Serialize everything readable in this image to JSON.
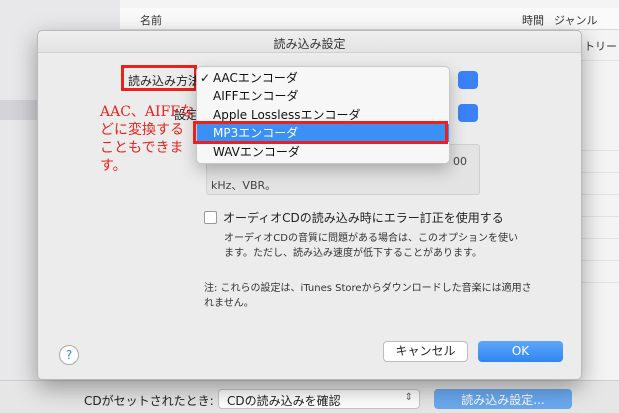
{
  "background": {
    "columns": {
      "name": "名前",
      "time": "時間",
      "genre": "ジャンル"
    },
    "tail_text": "トリー",
    "bottom_label": "CDがセットされたとき:",
    "bottom_select": "CDの読み込みを確認",
    "bottom_button": "読み込み設定..."
  },
  "dialog": {
    "title": "読み込み設定",
    "import_label": "読み込み方法",
    "setting_label": "設定",
    "info_tail": "00",
    "info_text": "kHz、VBR。",
    "checkbox_label": "オーディオCDの読み込み時にエラー訂正を使用する",
    "checkbox_desc": "オーディオCDの音質に問題がある場合は、このオプションを使います。ただし、読み込み速度が低下することがあります。",
    "note": "注: これらの設定は、iTunes Storeからダウンロードした音楽には適用されません。",
    "help": "?",
    "cancel": "キャンセル",
    "ok": "OK"
  },
  "annotation": {
    "text": "AAC、AIFFなどに変換することもできます。",
    "color": "#e8231d"
  },
  "menu": {
    "items": [
      {
        "label": "AACエンコーダ",
        "checked": "✓"
      },
      {
        "label": "AIFFエンコーダ"
      },
      {
        "label": "Apple Losslessエンコーダ"
      },
      {
        "label": "MP3エンコーダ"
      },
      {
        "label": "WAVエンコーダ"
      }
    ],
    "selected_index": 3
  },
  "colors": {
    "accent": "#3b8ff5",
    "highlight": "#e8231d"
  }
}
